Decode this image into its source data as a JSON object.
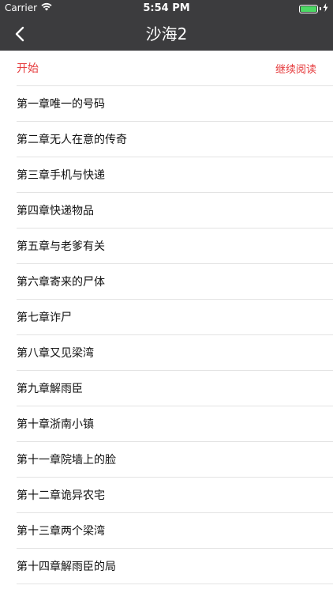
{
  "status_bar": {
    "carrier": "Carrier",
    "time": "5:54 PM",
    "battery_level": 1.0,
    "battery_color": "#4cd964"
  },
  "nav": {
    "title": "沙海2",
    "back_icon": "chevron-left-icon",
    "background": "#3c3c3e"
  },
  "header": {
    "start_label": "开始",
    "continue_label": "继续阅读",
    "accent_color": "#e5393b"
  },
  "chapters": [
    "第一章唯一的号码",
    "第二章无人在意的传奇",
    "第三章手机与快递",
    "第四章快递物品",
    "第五章与老爹有关",
    "第六章寄来的尸体",
    "第七章诈尸",
    "第八章又见梁湾",
    "第九章解雨臣",
    "第十章浙南小镇",
    "第十一章院墙上的脸",
    "第十二章诡异农宅",
    "第十三章两个梁湾",
    "第十四章解雨臣的局"
  ]
}
